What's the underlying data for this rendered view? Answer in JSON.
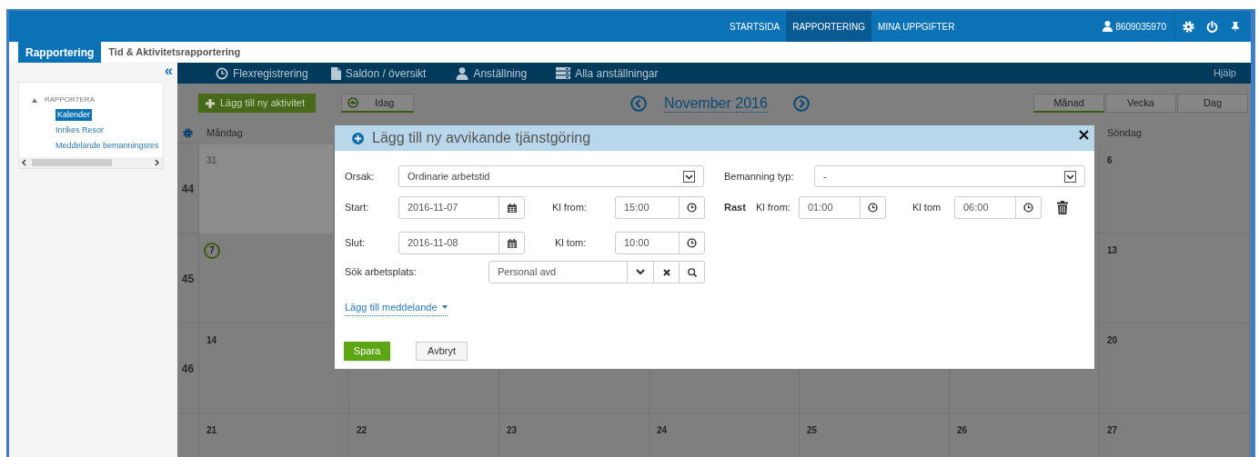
{
  "topbar": {
    "nav": [
      {
        "label": "STARTSIDA",
        "selected": false
      },
      {
        "label": "RAPPORTERING",
        "selected": true
      },
      {
        "label": "MINA UPPGIFTER",
        "selected": false
      }
    ],
    "user": "8609035970"
  },
  "app_tabs": [
    {
      "label": "Rapportering",
      "selected": true
    },
    {
      "label": "Tid & Aktivitetsrapportering",
      "selected": false
    }
  ],
  "subnav": {
    "items": [
      {
        "label": "Flexregistrering",
        "kind": "clock"
      },
      {
        "label": "Saldon / översikt",
        "kind": "document"
      },
      {
        "label": "Anställning",
        "kind": "person"
      },
      {
        "label": "Alla anställningar",
        "kind": "list"
      }
    ],
    "help": "Hjälp"
  },
  "sidebar": {
    "collapse": "«",
    "tree": [
      {
        "label": "RAPPORTERA",
        "expanded": true,
        "children": [
          {
            "label": "Kalender",
            "selected": true
          },
          {
            "label": "Inrikes Resor",
            "selected": false
          },
          {
            "label": "Meddelande bemanningsres",
            "selected": false
          }
        ]
      }
    ]
  },
  "calendar": {
    "add_button": "Lägg till ny aktivitet",
    "today_button": "Idag",
    "month": "November 2016",
    "views": [
      {
        "label": "Månad",
        "selected": true
      },
      {
        "label": "Vecka",
        "selected": false
      },
      {
        "label": "Dag",
        "selected": false
      }
    ],
    "weekdays": {
      "monday": "Måndag",
      "sunday": "Söndag"
    },
    "weeks": [
      {
        "number": "44",
        "days": {
          "monday": {
            "day": "31",
            "other_month": true
          },
          "sunday": {
            "day": "6",
            "other_month": false
          }
        }
      },
      {
        "number": "45",
        "days": {
          "monday": {
            "day": "7",
            "today": true
          },
          "sunday": {
            "day": "13",
            "today": false
          }
        }
      },
      {
        "number": "46",
        "days": {
          "monday": {
            "day": "14"
          },
          "sunday": {
            "day": "20"
          }
        }
      },
      {
        "days": {
          "monday": {
            "day": "21"
          },
          "tuesday": {
            "day": "22"
          },
          "wednesday": {
            "day": "23"
          },
          "thursday": {
            "day": "24"
          },
          "friday": {
            "day": "25"
          },
          "saturday": {
            "day": "26"
          },
          "sunday": {
            "day": "27"
          }
        }
      }
    ]
  },
  "dialog": {
    "title": "Lägg till ny avvikande tjänstgöring",
    "orsak": {
      "label": "Orsak:",
      "value": "Ordinarie arbetstid"
    },
    "bemanning": {
      "label": "Bemanning typ:",
      "value": "-"
    },
    "start": {
      "label": "Start:",
      "date": "2016-11-07",
      "time_label": "Kl from:",
      "time": "15:00"
    },
    "rast": {
      "label": "Rast",
      "from_label": "Kl from:",
      "from": "01:00",
      "to_label": "Kl tom",
      "to": "06:00"
    },
    "slut": {
      "label": "Slut:",
      "date": "2016-11-08",
      "time_label": "Kl tom:",
      "time": "10:00"
    },
    "workplace": {
      "label": "Sök arbetsplats:",
      "value": "Personal avd"
    },
    "message_link": "Lägg till meddelande",
    "buttons": [
      {
        "label": "Spara",
        "kind": "primary"
      },
      {
        "label": "Avbryt",
        "kind": "secondary"
      }
    ]
  }
}
